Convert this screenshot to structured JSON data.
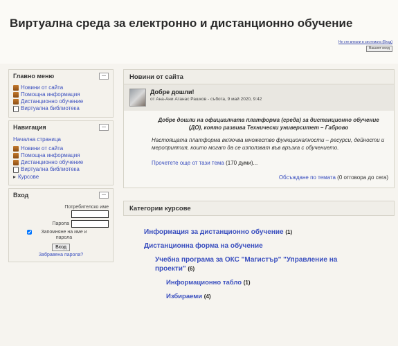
{
  "header": {
    "site_title": "Виртуална среда за електронно и дистанционно обучение",
    "login_text": "Не сте влезли в системата (Вход)",
    "logout_label": "Вашият вход"
  },
  "main_menu": {
    "title": "Главно меню",
    "items": [
      "Новини от сайта",
      "Помощна информация",
      "Дистанционно обучение",
      "Виртуална библиотека"
    ]
  },
  "navigation": {
    "title": "Навигация",
    "home": "Начална страница",
    "items": [
      "Новини от сайта",
      "Помощна информация",
      "Дистанционно обучение",
      "Виртуална библиотека"
    ],
    "courses": "Курсове"
  },
  "login": {
    "title": "Вход",
    "username_label": "Потребителско име",
    "password_label": "Парола",
    "remember_label": "Запомняне на име и парола",
    "submit_label": "Вход",
    "forgot_label": "Забравена парола?"
  },
  "news": {
    "title": "Новини от сайта",
    "post": {
      "subject": "Добре дошли!",
      "author_line": "от Ана-Ани Атанас Рашков - събота, 9 май 2020, 9:42",
      "welcome": "Добре дошли на официалната платформа (среда) за дистанционно обучение (ДО), която развива Технически университет – Габрово",
      "description": "Настоящата платформа включва множество функционалности – ресурси, дейности и мероприятия, които могат да се използват във връзка с обучението.",
      "read_more": "Прочетете още от тази тема",
      "read_more_count": "(170 думи)...",
      "discuss": "Обсъждане по темата",
      "discuss_count": "(0 отговора до сега)"
    }
  },
  "categories": {
    "title": "Категории курсове",
    "items": [
      {
        "name": "Информация за дистанционно обучение",
        "count": "(1)"
      },
      {
        "name": "Дистанционна форма на обучение",
        "count": ""
      },
      {
        "name": "Учебна програма за ОКС \"Магистър\" \"Управление на проекти\"",
        "count": "(6)"
      },
      {
        "name": "Информационно табло",
        "count": "(1)"
      },
      {
        "name": "Избираеми",
        "count": "(4)"
      }
    ]
  }
}
